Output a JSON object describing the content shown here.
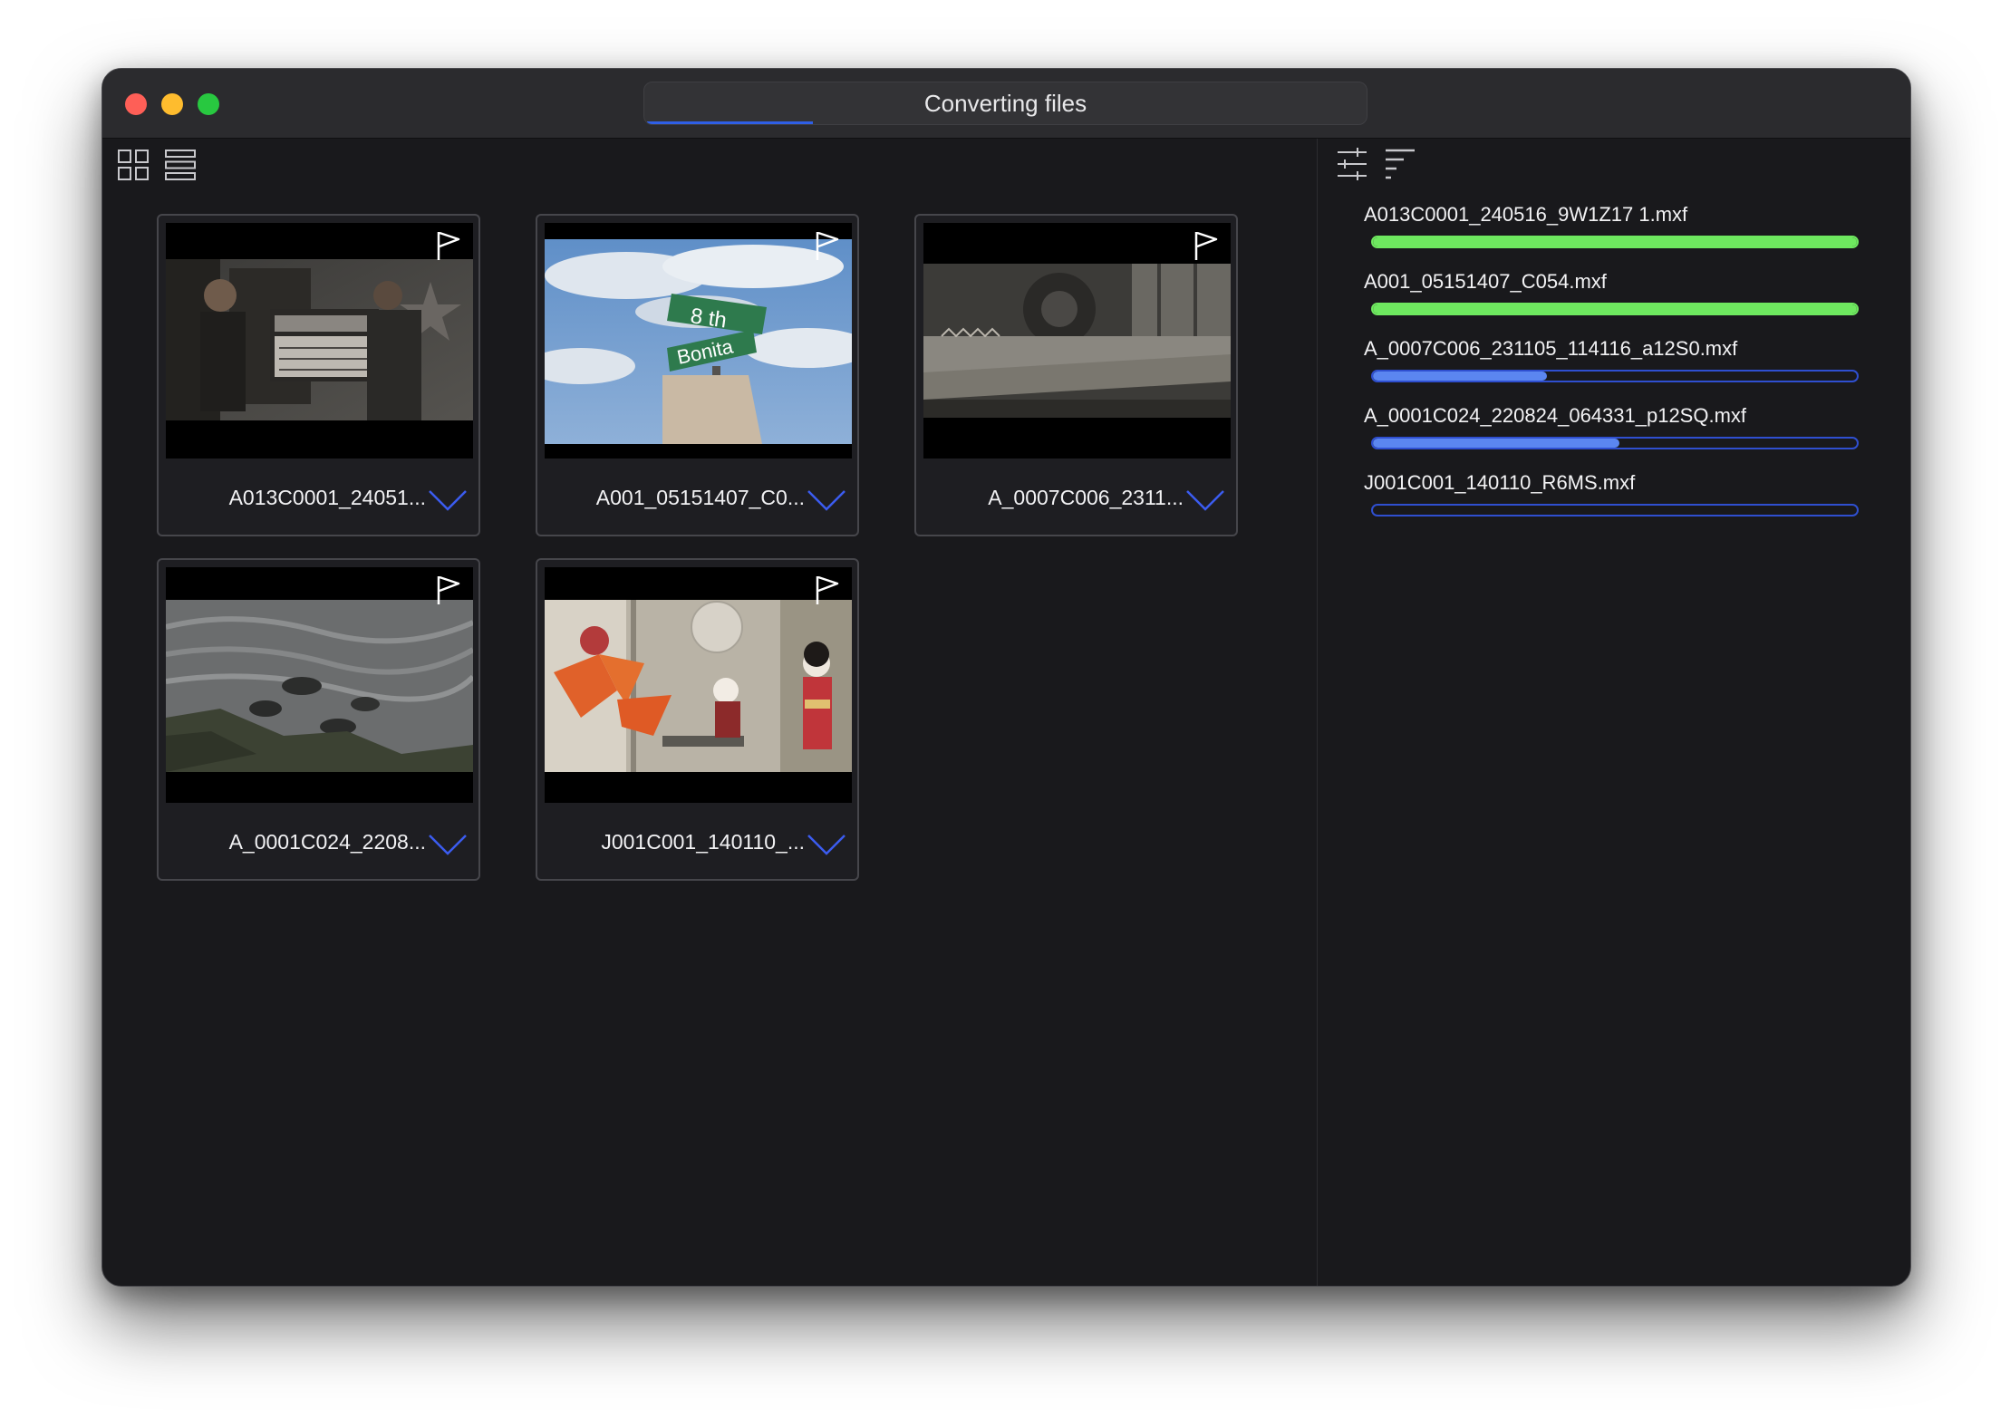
{
  "window": {
    "title": "Converting files",
    "title_progress": 0.23
  },
  "toolbar": {
    "grid_view_icon": "grid-view-icon",
    "list_view_icon": "list-view-icon",
    "settings_icon": "sliders-icon",
    "sort_icon": "sort-icon"
  },
  "clips": [
    {
      "label": "A013C0001_24051...",
      "scene": "film-set-clapperboard",
      "flag_icon": "flag-icon",
      "expand_icon": "chevron-down-icon"
    },
    {
      "label": "A001_05151407_C0...",
      "scene": "street-sign-sky",
      "flag_icon": "flag-icon",
      "expand_icon": "chevron-down-icon"
    },
    {
      "label": "A_0007C006_2311...",
      "scene": "workshop-saw",
      "flag_icon": "flag-icon",
      "expand_icon": "chevron-down-icon"
    },
    {
      "label": "A_0001C024_2208...",
      "scene": "ocean-rocks",
      "flag_icon": "flag-icon",
      "expand_icon": "chevron-down-icon"
    },
    {
      "label": "J001C001_140110_...",
      "scene": "butterflies-dolls",
      "flag_icon": "flag-icon",
      "expand_icon": "chevron-down-icon"
    }
  ],
  "queue": [
    {
      "filename": "A013C0001_240516_9W1Z17 1.mxf",
      "progress": 1.0,
      "status": "complete"
    },
    {
      "filename": "A001_05151407_C054.mxf",
      "progress": 1.0,
      "status": "complete"
    },
    {
      "filename": "A_0007C006_231105_114116_a12S0.mxf",
      "progress": 0.36,
      "status": "in-progress"
    },
    {
      "filename": "A_0001C024_220824_064331_p12SQ.mxf",
      "progress": 0.51,
      "status": "in-progress"
    },
    {
      "filename": "J001C001_140110_R6MS.mxf",
      "progress": 0.0,
      "status": "pending"
    }
  ],
  "colors": {
    "complete": "#6ee85f",
    "in_progress": "#5b86f0",
    "bar_border": "#2f4fd0",
    "accent": "#2f5fe6",
    "chevron": "#3b5cf0"
  }
}
